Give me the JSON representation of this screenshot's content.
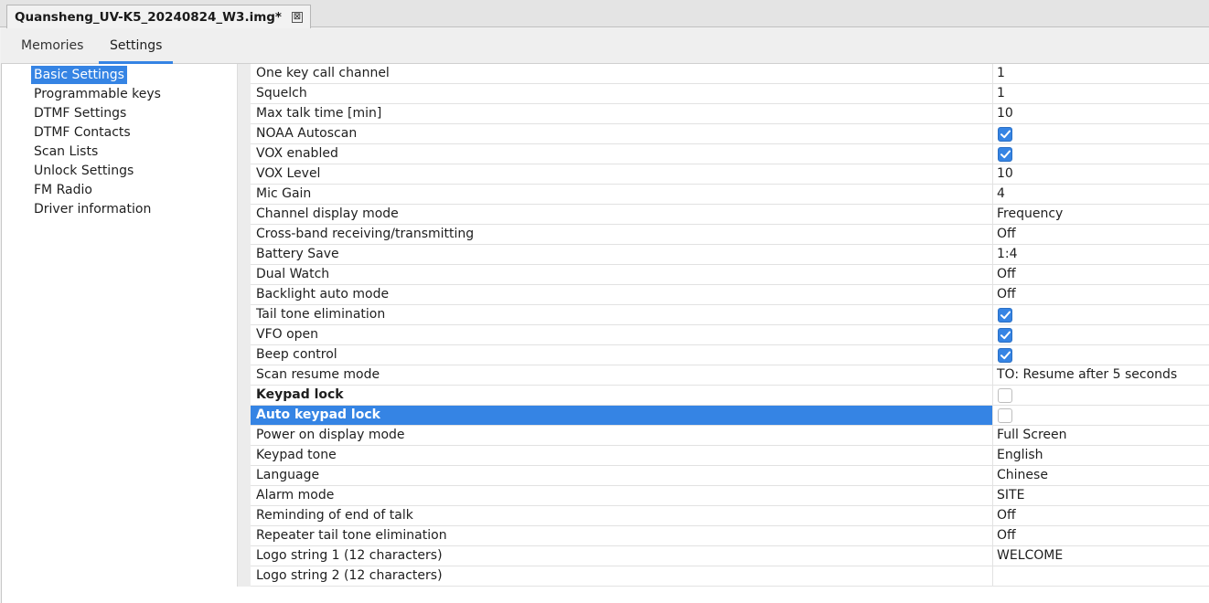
{
  "document_tab": {
    "title": "Quansheng_UV-K5_20240824_W3.img*",
    "close_glyph": "⊠"
  },
  "main_tabs": [
    {
      "label": "Memories",
      "active": false
    },
    {
      "label": "Settings",
      "active": true
    }
  ],
  "nav": {
    "items": [
      {
        "label": "Basic Settings",
        "selected": true
      },
      {
        "label": "Programmable keys"
      },
      {
        "label": "DTMF Settings"
      },
      {
        "label": "DTMF Contacts"
      },
      {
        "label": "Scan Lists"
      },
      {
        "label": "Unlock Settings"
      },
      {
        "label": "FM Radio"
      },
      {
        "label": "Driver information"
      }
    ]
  },
  "settings": [
    {
      "name": "One key call channel",
      "value": "1"
    },
    {
      "name": "Squelch",
      "value": "1"
    },
    {
      "name": "Max talk time [min]",
      "value": "10"
    },
    {
      "name": "NOAA Autoscan",
      "checked": true
    },
    {
      "name": "VOX enabled",
      "checked": true
    },
    {
      "name": "VOX Level",
      "value": "10"
    },
    {
      "name": "Mic Gain",
      "value": "4"
    },
    {
      "name": "Channel display mode",
      "value": "Frequency"
    },
    {
      "name": "Cross-band receiving/transmitting",
      "value": "Off"
    },
    {
      "name": "Battery Save",
      "value": "1:4"
    },
    {
      "name": "Dual Watch",
      "value": "Off"
    },
    {
      "name": "Backlight auto mode",
      "value": "Off"
    },
    {
      "name": "Tail tone elimination",
      "checked": true
    },
    {
      "name": "VFO open",
      "checked": true
    },
    {
      "name": "Beep control",
      "checked": true
    },
    {
      "name": "Scan resume mode",
      "value": "TO: Resume after 5 seconds"
    },
    {
      "name": "Keypad lock",
      "checked": false,
      "bold": true
    },
    {
      "name": "Auto keypad lock",
      "checked": false,
      "selected": true
    },
    {
      "name": "Power on display mode",
      "value": "Full Screen"
    },
    {
      "name": "Keypad tone",
      "value": "English"
    },
    {
      "name": "Language",
      "value": "Chinese"
    },
    {
      "name": "Alarm mode",
      "value": "SITE"
    },
    {
      "name": "Reminding of end of talk",
      "value": "Off"
    },
    {
      "name": "Repeater tail tone elimination",
      "value": "Off"
    },
    {
      "name": "Logo string 1 (12 characters)",
      "value": "WELCOME"
    },
    {
      "name": "Logo string 2 (12 characters)",
      "value": ""
    }
  ],
  "colors": {
    "accent": "#3584e4"
  }
}
